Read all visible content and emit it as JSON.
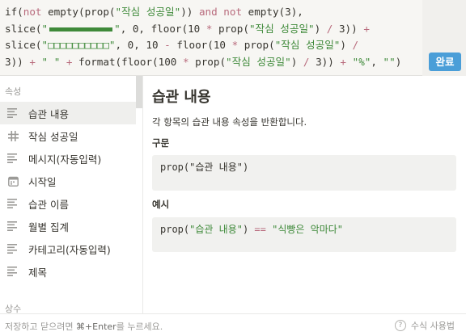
{
  "editor": {
    "line1": {
      "p1": "if(",
      "p2": "not",
      "p3": " empty(prop(",
      "p4": "\"작심 성공일\"",
      "p5": ")) ",
      "p6": "and",
      "p7": " ",
      "p8": "not",
      "p9": " empty(3),"
    },
    "line2": {
      "p1": "slice(",
      "p2": "\"",
      "p3": "\"",
      "p4": ", 0, floor(10 ",
      "p5": "*",
      "p6": " prop(",
      "p7": "\"작심 성공일\"",
      "p8": ") ",
      "p9": "/",
      "p10": " 3)) ",
      "p11": "+"
    },
    "line3": {
      "p1": "slice(",
      "p2": "\"□□□□□□□□□□\"",
      "p3": ", 0, 10 ",
      "p4": "-",
      "p5": " floor(10 ",
      "p6": "*",
      "p7": " prop(",
      "p8": "\"작심 성공일\"",
      "p9": ") ",
      "p10": "/"
    },
    "line4": {
      "p1": "3)) ",
      "p2": "+",
      "p3": " ",
      "p4": "\" \"",
      "p5": " ",
      "p6": "+",
      "p7": " format(floor(100 ",
      "p8": "*",
      "p9": " prop(",
      "p10": "\"작심 성공일\"",
      "p11": ") ",
      "p12": "/",
      "p13": " 3)) ",
      "p14": "+",
      "p15": " ",
      "p16": "\"%\"",
      "p17": ", ",
      "p18": "\"\"",
      "p19": ")"
    },
    "done_label": "완료"
  },
  "sidebar": {
    "section_properties": "속성",
    "items": [
      {
        "label": "습관 내용",
        "icon": "text-lines-icon",
        "active": true
      },
      {
        "label": "작심 성공일",
        "icon": "number-hash-icon",
        "active": false
      },
      {
        "label": "메시지(자동입력)",
        "icon": "text-lines-icon",
        "active": false
      },
      {
        "label": "시작일",
        "icon": "calendar-icon",
        "active": false
      },
      {
        "label": "습관 이름",
        "icon": "text-lines-icon",
        "active": false
      },
      {
        "label": "월별 집계",
        "icon": "text-lines-icon",
        "active": false
      },
      {
        "label": "카테고리(자동입력)",
        "icon": "text-lines-icon",
        "active": false
      },
      {
        "label": "제목",
        "icon": "text-lines-icon",
        "active": false
      }
    ],
    "section_constants": "상수"
  },
  "detail": {
    "title": "습관 내용",
    "description": "각 항목의 습관 내용 속성을 반환합니다.",
    "syntax_heading": "구문",
    "syntax_code": "prop(\"습관 내용\")",
    "example_heading": "예시",
    "example": {
      "p1": "prop(",
      "p2": "\"습관 내용\"",
      "p3": ") ",
      "p4": "==",
      "p5": " ",
      "p6": "\"식빵은 악마다\""
    }
  },
  "footer": {
    "hint_pre": "저장하고 닫으려면 ",
    "hint_key": "⌘+Enter",
    "hint_post": "를 누르세요.",
    "help_label": "수식 사용법",
    "help_icon_glyph": "?"
  },
  "colors": {
    "accent": "#4a9ed8",
    "string": "#3f8a3a",
    "keyword": "#b86a7c"
  }
}
